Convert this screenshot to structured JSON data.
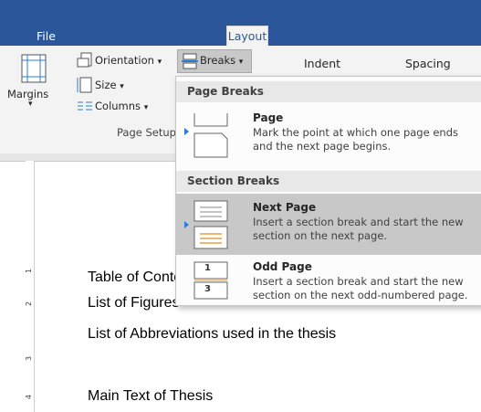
{
  "tabs": {
    "file": "File",
    "layout": "Layout"
  },
  "ribbon": {
    "margins": "Margins",
    "orientation": "Orientation",
    "size": "Size",
    "columns": "Columns",
    "breaks": "Breaks",
    "indent": "Indent",
    "spacing": "Spacing",
    "page_setup": "Page Setup",
    "dropdown_arrow": "▾"
  },
  "breaks_menu": {
    "page_breaks_header": "Page Breaks",
    "section_breaks_header": "Section Breaks",
    "items": [
      {
        "title": "Page",
        "desc": "Mark the point at which one page ends and the next page begins."
      },
      {
        "title": "Next Page",
        "desc": "Insert a section break and start the new section on the next page."
      },
      {
        "title": "Odd Page",
        "desc": "Insert a section break and start the new section on the next odd-numbered page."
      }
    ],
    "odd_page_icon_labels": [
      "1",
      "3"
    ]
  },
  "document": {
    "lines": [
      "Table of Contents",
      "List of Figures",
      "List of Abbreviations used in the thesis",
      "Main Text of Thesis"
    ]
  },
  "ruler": {
    "marks": [
      "1",
      "2",
      "3",
      "4"
    ]
  },
  "colors": {
    "accent": "#2b579a",
    "highlight": "#c8c8c8",
    "icon_orange": "#e8a040"
  }
}
